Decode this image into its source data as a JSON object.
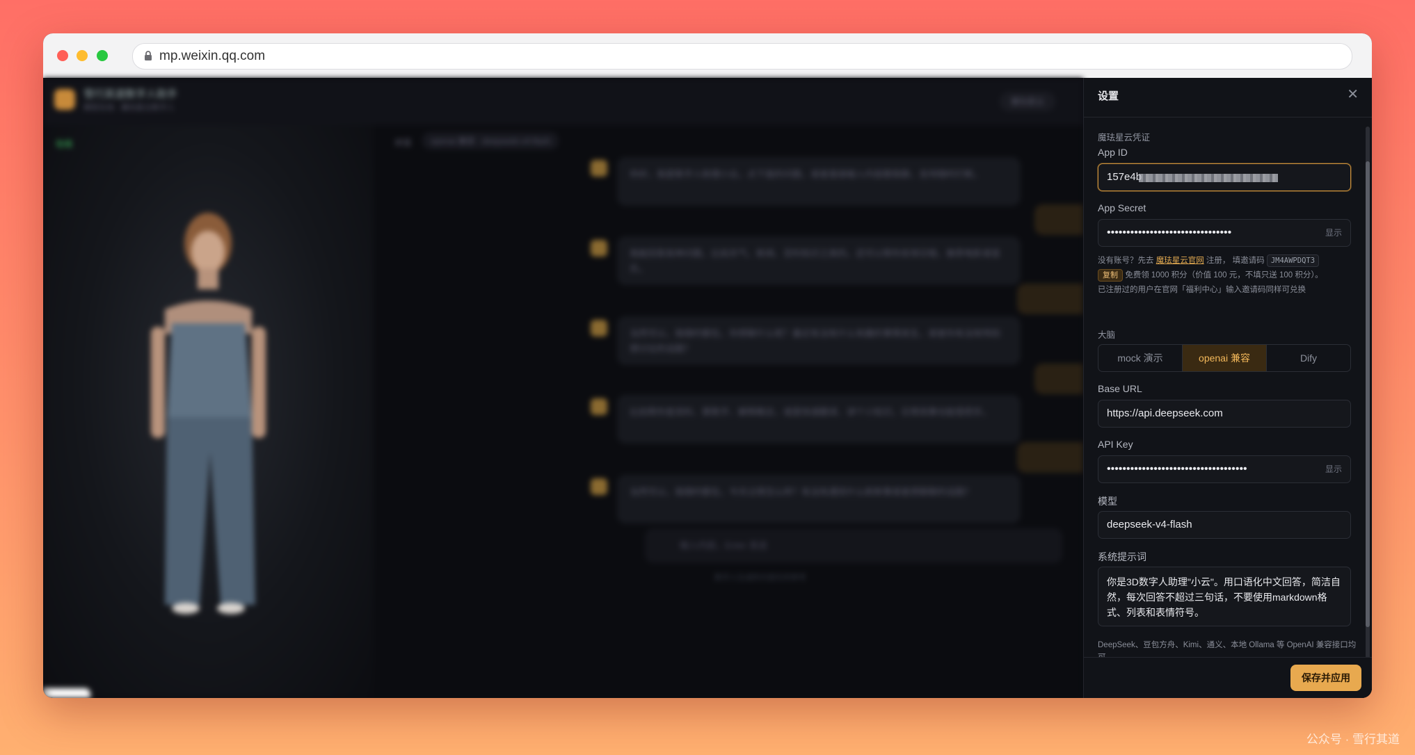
{
  "browser": {
    "url": "mp.weixin.qq.com"
  },
  "background_app": {
    "title": "雪行其道数字人助手",
    "subtitle": "模型在线 · 魔珐星云数字人",
    "top_button": "魔珐星云",
    "status": "在线",
    "chat_label": "对话",
    "model_pill": "openai 兼容 · deepseek-v4-flash",
    "messages": [
      "你好，我是数字人助理小云。点下面的问题，或者直接输入内容跟我聊，支持随时打断。",
      "我能回答各种问题，比如天气、新闻、百科知识之类的。还可以帮你安排日程，推荐电影或音乐。",
      "当然可以，我随时都在。你想聊什么呢？最近有没有什么有趣的事情发生，或者你有没有特别想讨论的话题？",
      "比如帮你查资料、算数字、解释概念，或是快速翻译、讲个小知识。日常琐事也能搭把手。",
      "当然可以，我随时都在。今天过得怎么样？有没有遇到什么新鲜事或者想聊聊的话题？"
    ],
    "input_placeholder": "输入内容，Enter 发送",
    "footer_note": "数字人生成的内容仅供参考"
  },
  "settings": {
    "title": "设置",
    "section_credentials": "魔珐星云凭证",
    "app_id_label": "App ID",
    "app_id_value": "157e4b",
    "app_secret_label": "App Secret",
    "app_secret_value": "••••••••••••••••••••••••••••••••",
    "show_label": "显示",
    "hint_prefix": "没有账号？先去",
    "hint_link": "魔珐星云官网",
    "hint_mid": "注册，  填邀请码",
    "invite_code": "JM4AWPDQT3",
    "copy_label": "复制",
    "hint_bonus": "免费领 1000 积分（价值 100 元，不填只送 100 积分）。",
    "hint_line3": "已注册过的用户在官网「福利中心」输入邀请码同样可兑换",
    "brain_label": "大脑",
    "brain_options": [
      "mock 演示",
      "openai 兼容",
      "Dify"
    ],
    "brain_selected": "openai 兼容",
    "base_url_label": "Base URL",
    "base_url_value": "https://api.deepseek.com",
    "api_key_label": "API Key",
    "api_key_value": "••••••••••••••••••••••••••••••••••••",
    "model_label": "模型",
    "model_value": "deepseek-v4-flash",
    "system_prompt_label": "系统提示词",
    "system_prompt_value": "你是3D数字人助理\"小云\"。用口语化中文回答，简洁自然，每次回答不超过三句话，不要使用markdown格式、列表和表情符号。",
    "compat_note": "DeepSeek、豆包方舟、Kimi、通义、本地 Ollama 等 OpenAI 兼容接口均可",
    "save_label": "保存并应用"
  },
  "watermark": "公众号 · 雪行其道",
  "colors": {
    "accent": "#e8a94f",
    "panel_bg": "#111318",
    "page_bg_top": "#ff6f66",
    "page_bg_bottom": "#ffb070"
  }
}
